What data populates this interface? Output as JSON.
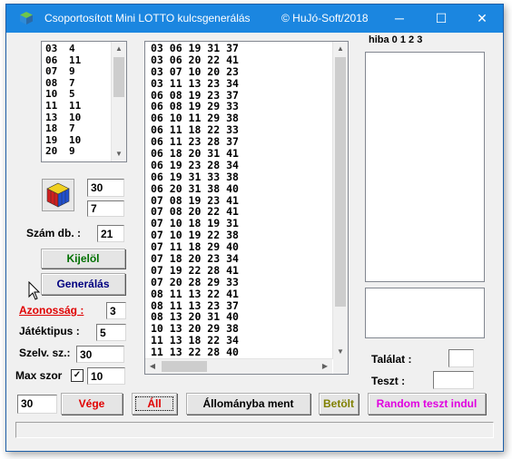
{
  "window": {
    "title": "Csoportosított Mini LOTTO kulcsgenerálás",
    "copyright": "© HuJó-Soft/2018",
    "minimize": "─",
    "maximize": "☐",
    "close": "✕"
  },
  "pairs_list": [
    [
      "03",
      "4"
    ],
    [
      "06",
      "11"
    ],
    [
      "07",
      "9"
    ],
    [
      "08",
      "7"
    ],
    [
      "10",
      "5"
    ],
    [
      "11",
      "11"
    ],
    [
      "13",
      "10"
    ],
    [
      "18",
      "7"
    ],
    [
      "19",
      "10"
    ],
    [
      "20",
      "9"
    ]
  ],
  "combos": [
    "03 06 19 31 37",
    "03 06 20 22 41",
    "03 07 10 20 23",
    "03 11 13 23 34",
    "06 08 19 23 37",
    "06 08 19 29 33",
    "06 10 11 29 38",
    "06 11 18 22 33",
    "06 11 23 28 37",
    "06 18 20 31 41",
    "06 19 23 28 34",
    "06 19 31 33 38",
    "06 20 31 38 40",
    "07 08 19 23 41",
    "07 08 20 22 41",
    "07 10 18 19 31",
    "07 10 19 22 38",
    "07 11 18 29 40",
    "07 18 20 23 34",
    "07 19 22 28 41",
    "07 20 28 29 33",
    "08 11 13 22 41",
    "08 11 13 23 37",
    "08 13 20 31 40",
    "10 13 20 29 38",
    "11 13 18 22 34",
    "11 13 22 28 40"
  ],
  "hiba_header": "hiba  0  1  2   3",
  "left_panel": {
    "value_30": "30",
    "value_7": "7",
    "szam_db_label": "Szám db. :",
    "szam_db_value": "21",
    "kijelol_label": "Kijelöl",
    "generalas_label": "Generálás",
    "azonossag_label": "Azonosság :",
    "azonossag_value": "3",
    "jatektipus_label": "Játéktipus :",
    "jatektipus_value": "5",
    "szelv_label": "Szelv. sz.:",
    "szelv_value": "30",
    "max_szor_label": "Max szor",
    "max_szor_checked": "✓",
    "max_szor_value": "10"
  },
  "right_panel": {
    "talalat_label": "Találat :",
    "talalat_value": "",
    "teszt_label": "Teszt :",
    "teszt_value": ""
  },
  "bottom_bar": {
    "count_value": "30",
    "vege_label": "Vége",
    "all_label": "Áll",
    "allomanyba_label": "Állományba ment",
    "betolt_label": "Betölt",
    "random_label": "Random teszt indul"
  },
  "colors": {
    "title_bar": "#1b86e0",
    "kijelol": "#007000",
    "generalas": "#000080",
    "azonossag": "#e00000",
    "vege": "#e00000",
    "all": "#e00000",
    "betolt": "#808000",
    "random": "#e000e0"
  }
}
